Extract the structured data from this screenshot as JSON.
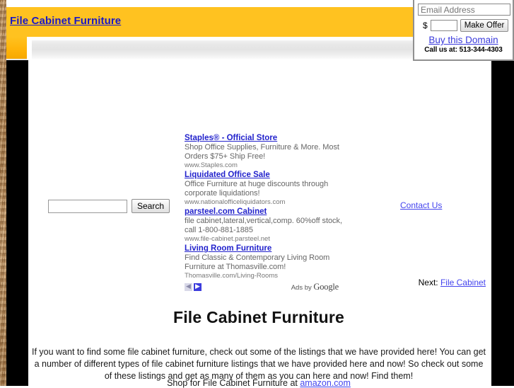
{
  "site": {
    "title_link": "File Cabinet Furniture",
    "page_heading": "File Cabinet Furniture"
  },
  "domain_widget": {
    "email_placeholder": "Email Address",
    "email_value": "",
    "currency_symbol": "$",
    "offer_value": "",
    "make_offer_label": "Make Offer",
    "buy_domain_label": "Buy this Domain",
    "call_us_text": "Call us at: 513-344-4303"
  },
  "search": {
    "input_value": "",
    "input_placeholder": "",
    "button_label": "Search"
  },
  "ads": {
    "units": [
      {
        "title": "Staples® - Official Store",
        "desc_line1": "Shop Office Supplies, Furniture & More. Most",
        "desc_line2": "Orders $75+ Ship Free!",
        "url": "www.Staples.com"
      },
      {
        "title": "Liquidated Office Sale",
        "desc_line1": "Office Furniture at huge discounts through",
        "desc_line2": "corporate liquidations!",
        "url": "www.nationalofficeliquidators.com"
      },
      {
        "title": "parsteel.com Cabinet",
        "desc_line1": "file cabinet,lateral,vertical,comp. 60%off stock,",
        "desc_line2": "call 1-800-881-1885",
        "url": "www.file-cabinet.parsteel.net"
      },
      {
        "title": "Living Room Furniture",
        "desc_line1": "Find Classic & Contemporary Living Room",
        "desc_line2": "Furniture at Thomasville.com!",
        "url": "Thomasville.com/Living-Rooms"
      }
    ],
    "prev_arrow": "◀",
    "next_arrow": "▶",
    "attribution_prefix": "Ads by ",
    "attribution_brand": "Google"
  },
  "links": {
    "contact_us": "Contact Us",
    "next_prefix": "Next: ",
    "next_label": "File Cabinet"
  },
  "content": {
    "paragraph": "If you want to find some file cabinet furniture, check out some of the listings that we have provided here! You can get a number of different types of file cabinet furniture listings that we have provided here and now! So check out some of these listings and get as many of them as you can here and now! Find them!",
    "shop_prefix": "Shop for File Cabinet Furniture at ",
    "shop_link": "amazon.com"
  },
  "colors": {
    "header_gold": "#ffc220",
    "link_blue": "#4444ee",
    "ad_title_blue": "#2222cc",
    "frame_black": "#000000",
    "wood_brown": "#b08a5e"
  }
}
